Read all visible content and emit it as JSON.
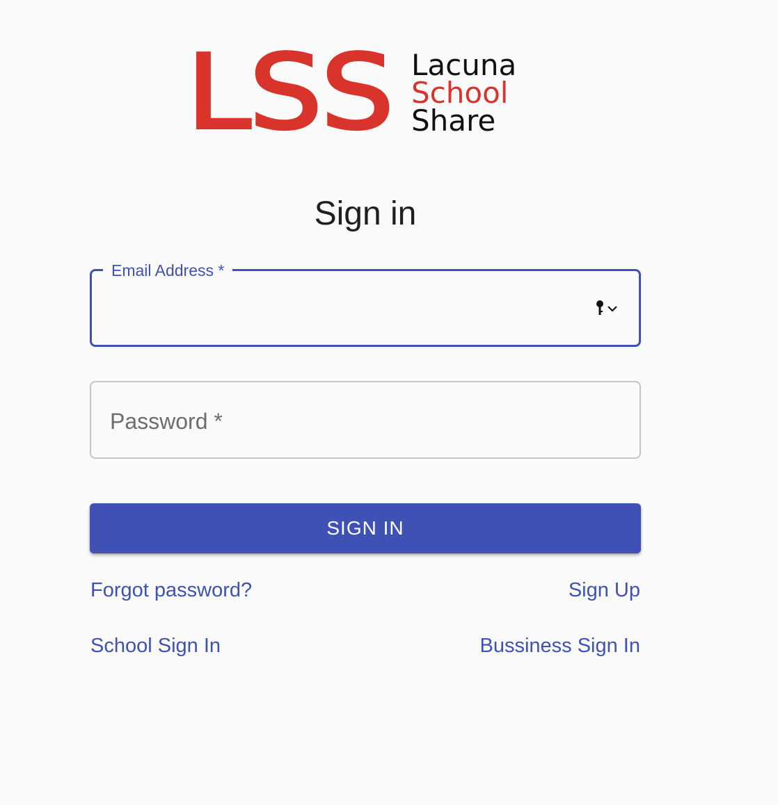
{
  "logo": {
    "mark": "LSS",
    "line1": "Lacuna",
    "line2": "School",
    "line3": "Share",
    "mark_color": "#d9342b"
  },
  "title": "Sign in",
  "email_field": {
    "label": "Email Address *",
    "value": "",
    "trailing_icon": "keychain-autofill-icon"
  },
  "password_field": {
    "placeholder": "Password *",
    "value": ""
  },
  "sign_in_button": "SIGN IN",
  "links": {
    "forgot_password": "Forgot password?",
    "sign_up": "Sign Up",
    "school_sign_in": "School Sign In",
    "business_sign_in": "Bussiness Sign In"
  },
  "colors": {
    "primary": "#3f51b5",
    "brand_red": "#d9342b",
    "background": "#fafafa"
  }
}
